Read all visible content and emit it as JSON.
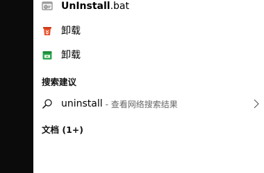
{
  "results": [
    {
      "name_main": "UnInstall",
      "name_ext": ".bat",
      "icon": "bat-file-icon"
    },
    {
      "label": "卸载",
      "icon": "uninstall-app-icon-orange"
    },
    {
      "label": "卸载",
      "icon": "uninstall-app-icon-green"
    }
  ],
  "search_suggestions": {
    "header": "搜索建议",
    "query": "uninstall",
    "suffix": "- 查看网络搜索结果",
    "icon": "search-icon",
    "chevron": "chevron-right-icon"
  },
  "documents": {
    "header": "文档 (1+)"
  },
  "colors": {
    "rail": "#0b0b0b",
    "orange": "#e8502a",
    "green": "#2fa84f",
    "muted": "#666666"
  }
}
